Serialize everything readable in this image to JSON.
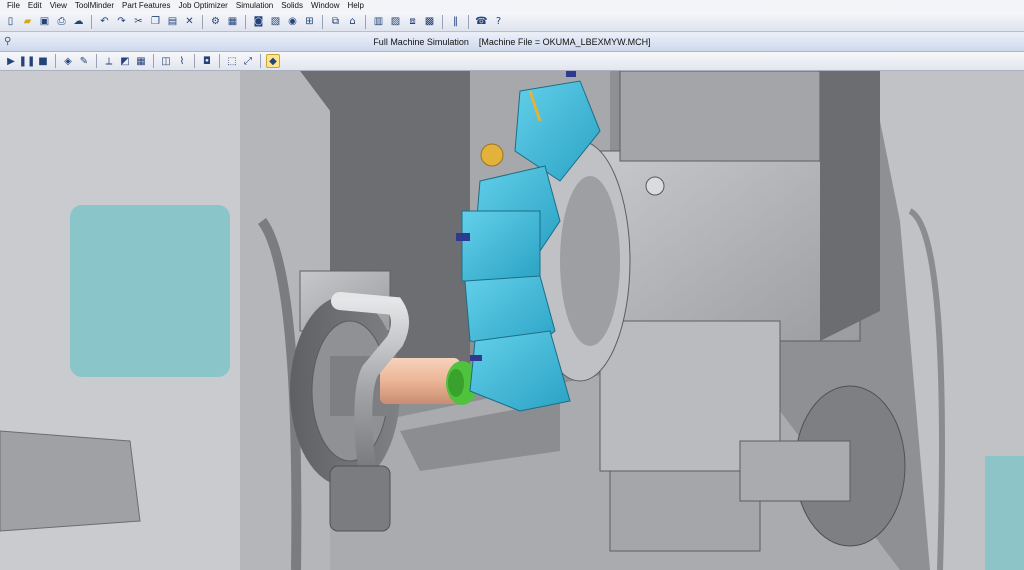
{
  "menu": {
    "items": [
      "File",
      "Edit",
      "View",
      "ToolMinder",
      "Part Features",
      "Job Optimizer",
      "Simulation",
      "Solids",
      "Window",
      "Help"
    ]
  },
  "main_toolbar": {
    "icons": [
      "new-file-icon",
      "open-folder-icon",
      "save-icon",
      "print-icon",
      "cloud-icon",
      "undo-icon",
      "redo-icon",
      "cut-icon",
      "copy-icon",
      "paste-icon",
      "tools-icon",
      "machine-setup-icon",
      "post-icon",
      "gear-icon",
      "layers-icon",
      "window-icon",
      "grid-icon",
      "report-icon",
      "cascade-icon",
      "export-icon",
      "tile-icon",
      "split-icon",
      "phone-icon",
      "help-icon"
    ]
  },
  "window": {
    "title": "Full Machine Simulation",
    "machine_file": "[Machine File = OKUMA_LBEXMYW.MCH]"
  },
  "sim_toolbar": {
    "icons": [
      "play-icon",
      "pause-icon",
      "stop-icon",
      "view-3d-icon",
      "pencil-icon",
      "measure-icon",
      "section-icon",
      "table-icon",
      "clamp-icon",
      "tool-icon",
      "camera-icon",
      "zoom-icon",
      "fit-icon",
      "collision-icon"
    ]
  },
  "colors": {
    "turret_cyan": "#3fb8d6",
    "machine_gray": "#b5b7ba",
    "workpiece": "#f0c2a8",
    "cut_green": "#4fc23e",
    "glass_teal": "#7fc4c8",
    "toolbar_accent": "#23437a"
  }
}
